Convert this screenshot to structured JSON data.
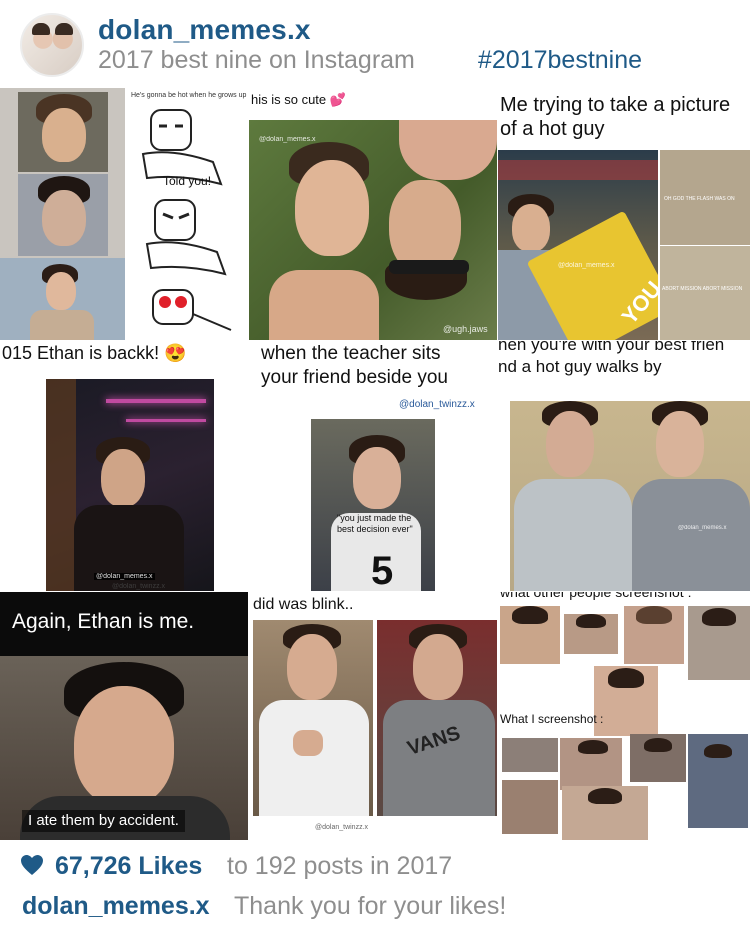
{
  "header": {
    "username": "dolan_memes.x",
    "subtitle": "2017 best nine on Instagram",
    "hashtag": "#2017bestnine"
  },
  "posts": [
    {
      "caption_top": "He's gonna be hot when he grows up",
      "comic_text": "Told you!"
    },
    {
      "caption_top": "his is so cute 💕",
      "watermark_1": "@dolan_memes.x",
      "watermark_2": "@ugh.jaws"
    },
    {
      "caption_top_line1": "Me trying to take a picture",
      "caption_top_line2": "of a hot guy",
      "panel_text_1": "OH GOD THE FLASH WAS ON",
      "panel_text_2": "ABORT MISSION ABORT MISSION",
      "watermark": "@dolan_memes.x",
      "sign_text": "YOU"
    },
    {
      "caption_top": "015 Ethan is backk! 😍",
      "watermark_1": "@dolan_memes.x",
      "watermark_2": "@dolan_twinzz.x"
    },
    {
      "caption_top_line1": "when the teacher sits",
      "caption_top_line2": "your friend beside you",
      "handle": "@dolan_twinzz.x",
      "speech": "\"you just made the best decision ever\""
    },
    {
      "caption_top_line1": "hen you're with your best frien",
      "caption_top_line2": "nd a hot guy walks by",
      "watermark": "@dolan_memes.x"
    },
    {
      "caption_top": "Again, Ethan is me.",
      "caption_bottom": "I ate them by accident."
    },
    {
      "caption_top": "did was blink..",
      "watermark": "@dolan_twinzz.x",
      "shirt_text": "VANS"
    },
    {
      "caption_top": "what other people screenshot :",
      "caption_mid": "What I screenshot :"
    }
  ],
  "footer": {
    "likes": "67,726 Likes",
    "likes_rest": "to 192 posts in 2017",
    "caption_user": "dolan_memes.x",
    "caption_text": "Thank you for your likes!"
  },
  "colors": {
    "link_blue": "#1f5a87",
    "muted_gray": "#8e8e8e"
  },
  "icons": [
    "heart-icon"
  ]
}
